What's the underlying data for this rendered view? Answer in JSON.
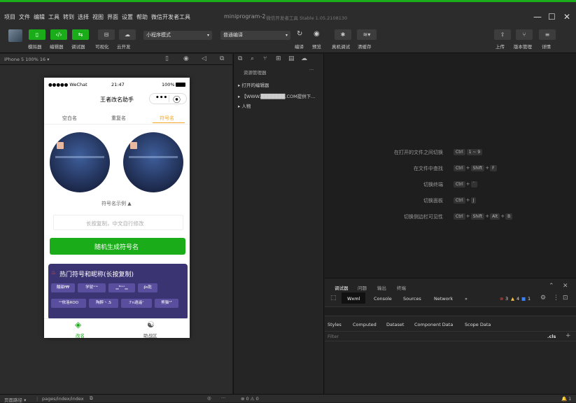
{
  "menubar": {
    "items": [
      "项目",
      "文件",
      "编辑",
      "工具",
      "转到",
      "选择",
      "视图",
      "界面",
      "设置",
      "帮助",
      "微信开发者工具"
    ],
    "project_name": "miniprogram-2",
    "app_version": "- 微信开发者工具 Stable 1.05.2108130",
    "window_controls": [
      "—",
      "☐",
      "✕"
    ]
  },
  "toolbar": {
    "left_labels": [
      "模拟器",
      "编辑器",
      "调试器",
      "可视化",
      "云开发"
    ],
    "mode_select": "小程序模式",
    "compile_select": "普通编译",
    "right_labels_1": [
      "编译",
      "预览",
      "真机调试",
      "清缓存"
    ],
    "right_labels_2": [
      "上传",
      "版本管理",
      "详情"
    ]
  },
  "simulator": {
    "device": "iPhone 5 100% 16 ▾"
  },
  "phone": {
    "status_left": "●●●●● WeChat",
    "status_time": "21:47",
    "status_battery": "100%",
    "nav_title": "王者改名助手",
    "capsule_dots": "•••",
    "tabs": [
      "空白名",
      "重复名",
      "符号名"
    ],
    "active_tab_index": 2,
    "example_label": "符号名示例 ▲",
    "input_placeholder": "长按复制，中文自行修改",
    "generate_button": "随机生成符号名",
    "hot_title": "热门符号和昵称(长按复制)",
    "hot_row1": [
      "酸甜f₩",
      "学就ᵒⁿᵉ",
      "▁ᴮᵒˢˢ▁",
      "∮ʀ乾"
    ],
    "hot_row2": [
      "ˣ⁰依洛ROO",
      "陶醉丶.S",
      "ℱn逍遥ᐟ",
      "熊猫ᴬᴾ"
    ],
    "bottom_tabs": [
      "改名",
      "助战区"
    ]
  },
  "tree": {
    "header": "资源管理器",
    "more": "···",
    "items": [
      "▸ 打开的编辑器",
      "▸ 【WWW.███████.COM提供下...",
      "▸ 人物"
    ]
  },
  "editor": {
    "hints": [
      {
        "label": "在打开的文件之间切换",
        "keys": [
          "Ctrl",
          "1 ~ 9"
        ]
      },
      {
        "label": "在文件中查找",
        "keys": [
          "Ctrl",
          "Shift",
          "F"
        ]
      },
      {
        "label": "切换终端",
        "keys": [
          "Ctrl",
          "`"
        ]
      },
      {
        "label": "切换面板",
        "keys": [
          "Ctrl",
          "J"
        ]
      },
      {
        "label": "切换侧边栏可见性",
        "keys": [
          "Ctrl",
          "Shift",
          "Alt",
          "B"
        ]
      }
    ]
  },
  "devtools": {
    "top_tabs": [
      "调试器",
      "问题",
      "输出",
      "终端"
    ],
    "tabs": [
      "Wxml",
      "Console",
      "Sources",
      "Network",
      "»"
    ],
    "errors": "3",
    "warnings": "4",
    "infos": "1",
    "sub_tabs": [
      "Styles",
      "Computed",
      "Dataset",
      "Component Data",
      "Scope Data"
    ],
    "filter_placeholder": "Filter",
    "cls_label": ".cls"
  },
  "statusbar": {
    "path_label": "页面路径 ▾",
    "path": "pages/index/index",
    "problems": "⊗ 0 ⚠ 0",
    "bell": "🔔 1"
  },
  "colors": {
    "accent": "#1aad19",
    "tab_active": "#f5a623",
    "hot_bg": "#3b3472"
  }
}
